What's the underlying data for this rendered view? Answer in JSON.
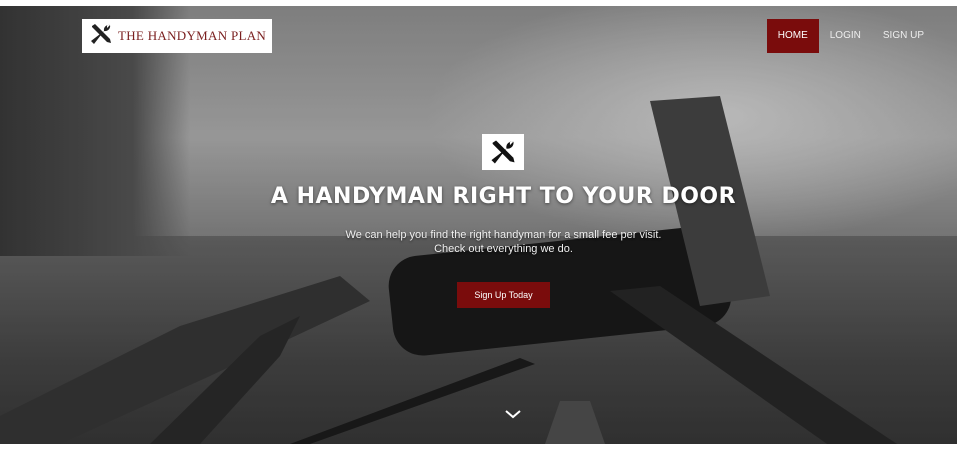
{
  "brand": {
    "name": "THE HANDYMAN PLAN",
    "icon": "tools-icon"
  },
  "nav": {
    "items": [
      {
        "label": "HOME",
        "active": true
      },
      {
        "label": "LOGIN",
        "active": false
      },
      {
        "label": "SIGN UP",
        "active": false
      }
    ]
  },
  "hero": {
    "icon": "tools-icon",
    "headline": "A HANDYMAN RIGHT TO YOUR DOOR",
    "subline_1": "We can help you find the right handyman for a small fee per visit.",
    "subline_2": "Check out everything we do.",
    "cta_label": "Sign Up Today",
    "scroll_icon": "chevron-down-icon"
  },
  "colors": {
    "accent": "#7a0c0c",
    "brand_text": "#7a1f1f"
  }
}
